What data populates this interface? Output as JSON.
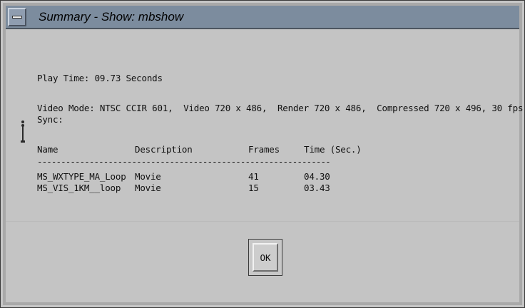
{
  "window": {
    "title": "Summary - Show: mbshow"
  },
  "summary": {
    "play_time": "Play Time: 09.73 Seconds",
    "video_mode": "Video Mode: NTSC CCIR 601,  Video 720 x 486,  Render 720 x 486,  Compressed 720 x 496, 30 fps",
    "sync": "Sync:"
  },
  "table": {
    "headers": [
      "Name",
      "Description",
      "Frames",
      "Time (Sec.)"
    ],
    "separator": "--------------------------------------------------------------",
    "rows": [
      [
        "MS_WXTYPE_MA_Loop",
        "Movie",
        "41",
        "04.30"
      ],
      [
        "MS_VIS_1KM__loop",
        "Movie",
        "15",
        "03.43"
      ]
    ]
  },
  "buttons": {
    "ok_label": "OK"
  },
  "colors": {
    "titlebar": "#7c8c9e",
    "background": "#c4c4c4"
  },
  "icons": {
    "window_menu": "window-menu-icon",
    "resize_grip": "resize-grip-icon"
  }
}
